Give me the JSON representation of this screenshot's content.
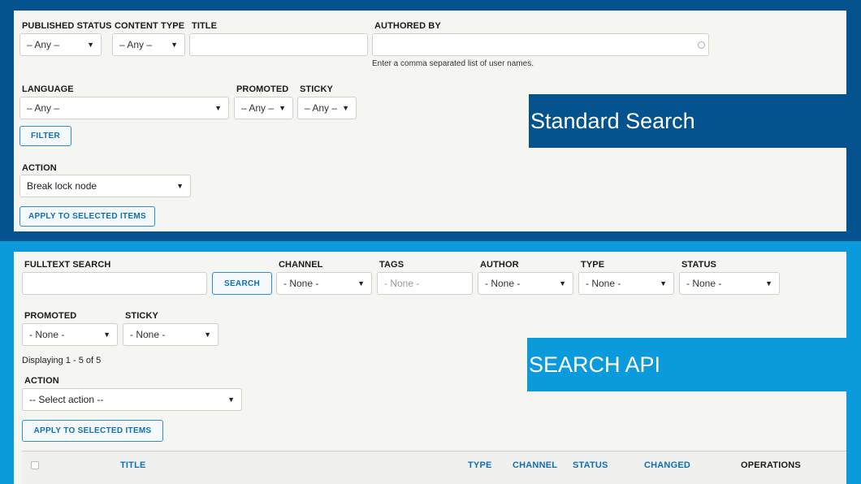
{
  "standard": {
    "banner": "Standard Search",
    "filters": {
      "published_status": {
        "label": "PUBLISHED STATUS",
        "value": "– Any –"
      },
      "content_type": {
        "label": "CONTENT TYPE",
        "value": "– Any –"
      },
      "title": {
        "label": "TITLE",
        "value": ""
      },
      "authored_by": {
        "label": "AUTHORED BY",
        "value": "",
        "help": "Enter a comma separated list of user names."
      },
      "language": {
        "label": "LANGUAGE",
        "value": "– Any –"
      },
      "promoted": {
        "label": "PROMOTED",
        "value": "– Any –"
      },
      "sticky": {
        "label": "STICKY",
        "value": "– Any –"
      }
    },
    "filter_button": "FILTER",
    "action": {
      "label": "ACTION",
      "value": "Break lock node"
    },
    "apply_button": "APPLY TO SELECTED ITEMS"
  },
  "search_api": {
    "banner": "SEARCH API",
    "filters": {
      "fulltext": {
        "label": "FULLTEXT SEARCH",
        "value": ""
      },
      "search_button": "SEARCH",
      "channel": {
        "label": "CHANNEL",
        "value": "- None -"
      },
      "tags": {
        "label": "TAGS",
        "placeholder": "- None -"
      },
      "author": {
        "label": "AUTHOR",
        "value": "- None -"
      },
      "type": {
        "label": "TYPE",
        "value": "- None -"
      },
      "status": {
        "label": "STATUS",
        "value": "- None -"
      },
      "promoted": {
        "label": "PROMOTED",
        "value": "- None -"
      },
      "sticky": {
        "label": "STICKY",
        "value": "- None -"
      }
    },
    "displaying": "Displaying 1 - 5 of 5",
    "action": {
      "label": "ACTION",
      "value": "-- Select action --"
    },
    "apply_button": "APPLY TO SELECTED ITEMS",
    "table_headers": {
      "title": "TITLE",
      "type": "TYPE",
      "channel": "CHANNEL",
      "status": "STATUS",
      "changed": "CHANGED",
      "operations": "OPERATIONS"
    }
  },
  "colors": {
    "dark_blue": "#04538f",
    "light_blue": "#0b9bdd",
    "panel": "#f5f5f2",
    "link": "#0f6fb4"
  }
}
